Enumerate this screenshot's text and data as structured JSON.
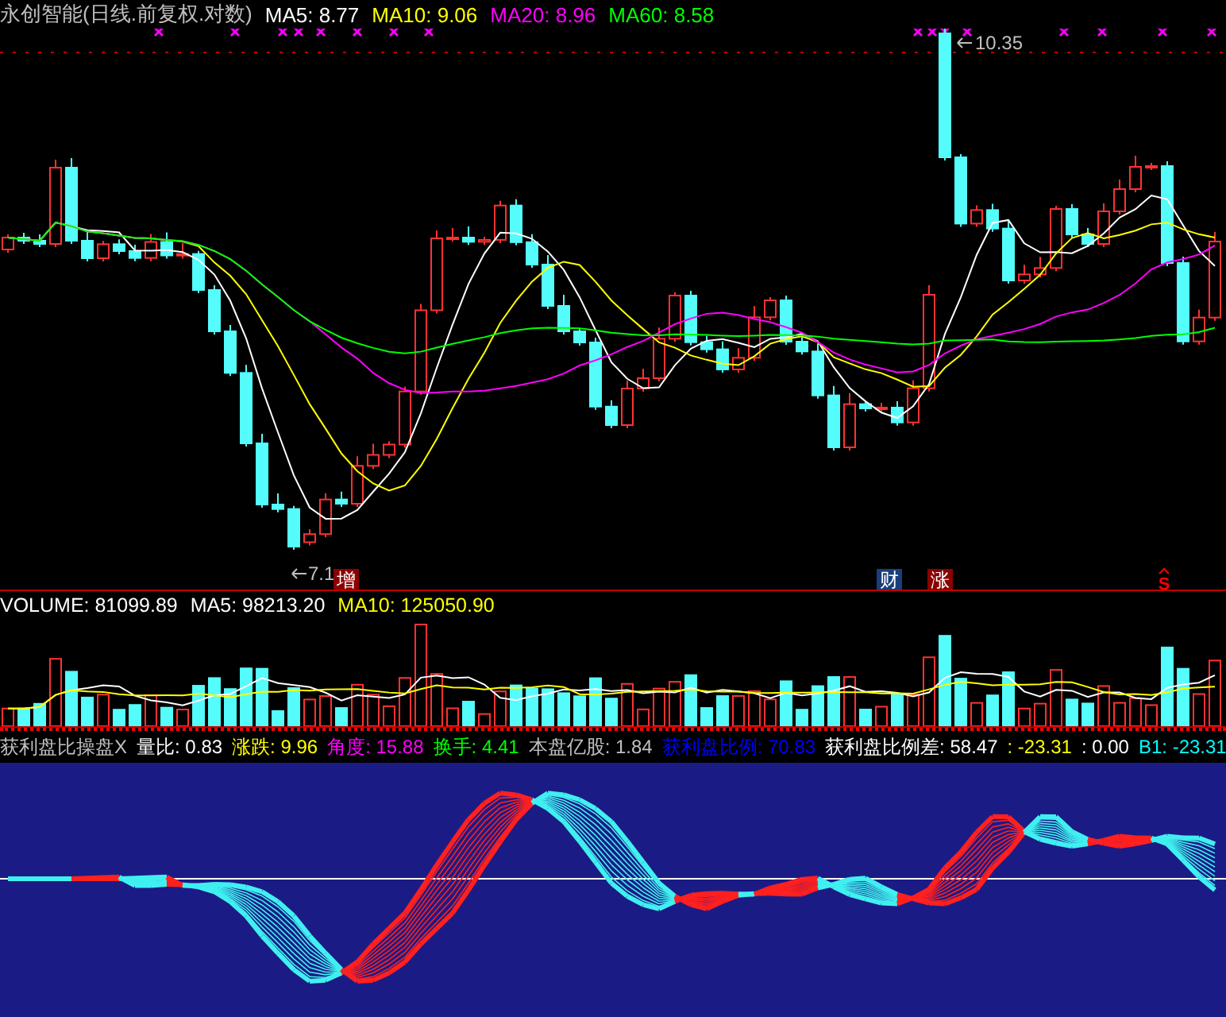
{
  "title_bar": {
    "security": "永创智能(日线.前复权.对数)",
    "indicators": [
      {
        "label": "MA5: 8.77",
        "color": "#ffffff"
      },
      {
        "label": "MA10: 9.06",
        "color": "#ffff00"
      },
      {
        "label": "MA20: 8.96",
        "color": "#ff00ff"
      },
      {
        "label": "MA60: 8.58",
        "color": "#00ff00"
      }
    ]
  },
  "price_labels": {
    "high": "10.35",
    "low": "7.1"
  },
  "event_markers": [
    {
      "text": "增",
      "kind": "badge",
      "color": "#8b0000"
    },
    {
      "text": "财",
      "kind": "badge",
      "color": "#1a3d7c"
    },
    {
      "text": "涨",
      "kind": "badge",
      "color": "#8b0000"
    },
    {
      "text": "S",
      "kind": "signal",
      "color": "#ff0000"
    }
  ],
  "volume_header": [
    {
      "label": "VOLUME: 81099.89",
      "color": "#ffffff"
    },
    {
      "label": "MA5: 98213.20",
      "color": "#ffffff"
    },
    {
      "label": "MA10: 125050.90",
      "color": "#ffff00"
    }
  ],
  "indicator_header": [
    {
      "label": "获利盘比操盘X",
      "color": "#c0c0c0"
    },
    {
      "label": "量比: 0.83",
      "color": "#ffffff"
    },
    {
      "label": "涨跌: 9.96",
      "color": "#ffff00"
    },
    {
      "label": "角度: 15.88",
      "color": "#ff00ff"
    },
    {
      "label": "换手: 4.41",
      "color": "#00ff00"
    },
    {
      "label": "本盘亿股: 1.84",
      "color": "#c0c0c0"
    },
    {
      "label": "获利盘比例: 70.83",
      "color": "#0000ff"
    },
    {
      "label": "获利盘比例差: 58.47",
      "color": "#ffffff"
    },
    {
      "label": ": -23.31",
      "color": "#ffff00"
    },
    {
      "label": ": 0.00",
      "color": "#ffffff"
    },
    {
      "label": "B1: -23.31",
      "color": "#00ffff"
    }
  ]
}
